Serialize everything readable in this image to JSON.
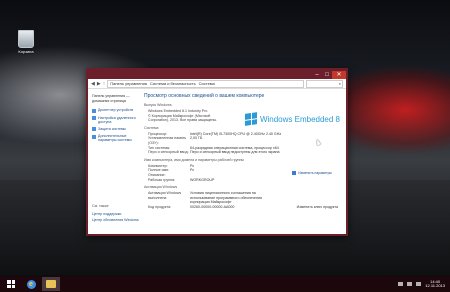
{
  "desktop": {
    "recycle_bin_label": "Корзина"
  },
  "window": {
    "minimize": "–",
    "maximize": "□",
    "close": "✕",
    "address": {
      "back": "◀",
      "forward": "▶",
      "up": "↑",
      "crumbs": [
        "Панель управления",
        "Система и безопасность",
        "Система"
      ],
      "search_placeholder": "Поиск в панели управления"
    },
    "left": {
      "home": "Панель управления — домашняя страница",
      "links": [
        "Диспетчер устройств",
        "Настройка удаленного доступа",
        "Защита системы",
        "Дополнительные параметры системы"
      ],
      "see_also": "См. также",
      "see_also_links": [
        "Центр поддержки",
        "Центр обновления Windows"
      ]
    },
    "main": {
      "heading": "Просмотр основных сведений о вашем компьютере",
      "sec_edition": "Выпуск Windows",
      "edition_name": "Windows Embedded 8.1 Industry Pro",
      "copyright": "© Корпорация Майкрософт (Microsoft Corporation), 2013. Все права защищены.",
      "logo_text": "Windows Embedded 8",
      "sec_system": "Система",
      "system_rows": [
        {
          "k": "Процессор:",
          "v": "Intel(R) Core(TM) i5-7300HQ CPU @ 2.40GHz  2.40 GHz"
        },
        {
          "k": "Установленная память (ОЗУ):",
          "v": "2,00 ГБ"
        },
        {
          "k": "Тип системы:",
          "v": "64-разрядная операционная система, процессор x64"
        },
        {
          "k": "Перо и сенсорный ввод:",
          "v": "Перо и сенсорный ввод недоступны для этого экрана"
        }
      ],
      "sec_name": "Имя компьютера, имя домена и параметры рабочей группы",
      "name_rows": [
        {
          "k": "Компьютер:",
          "v": "Pc"
        },
        {
          "k": "Полное имя:",
          "v": "Pc"
        },
        {
          "k": "Описание:",
          "v": ""
        },
        {
          "k": "Рабочая группа:",
          "v": "WORKGROUP"
        }
      ],
      "change_settings": "Изменить параметры",
      "sec_activation": "Активация Windows",
      "activation_label": "Активация Windows выполнена",
      "activation_link": "Условия лицензионного соглашения на использование программного обеспечения корпорации Майкрософт",
      "product_key_label": "Код продукта:",
      "product_key_value": "00260-00000-00000-AA000",
      "activation_other": "Изменить ключ продукта"
    }
  },
  "taskbar": {
    "time": "14:40",
    "date": "12.11.2013"
  }
}
